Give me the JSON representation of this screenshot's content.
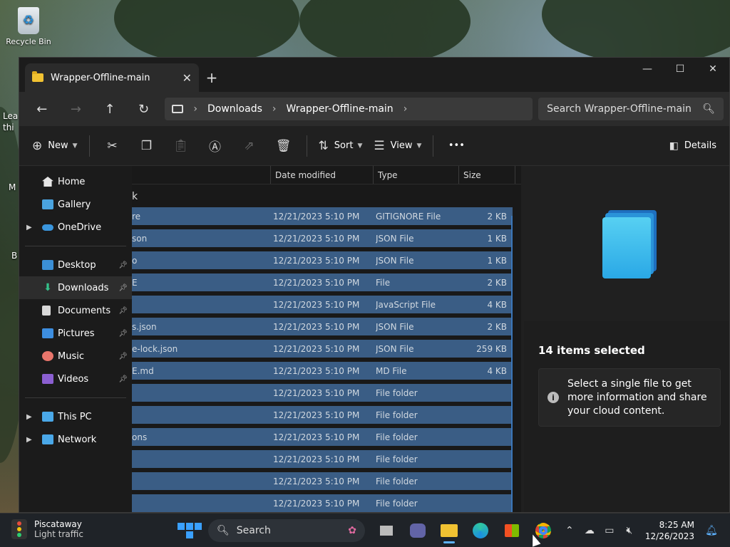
{
  "desktop": {
    "recycle_bin_label": "Recycle Bin",
    "partial_texts": [
      "Lea",
      "thi",
      "M",
      "B"
    ]
  },
  "window": {
    "tab_title": "Wrapper-Offline-main",
    "close_tab": "✕",
    "new_tab": "+",
    "minimize": "—",
    "maximize": "☐",
    "close": "✕"
  },
  "nav": {
    "back": "←",
    "forward": "→",
    "up": "↑",
    "refresh": "↻",
    "breadcrumbs": [
      "Downloads",
      "Wrapper-Offline-main"
    ],
    "sep": "›",
    "search_placeholder": "Search Wrapper-Offline-main"
  },
  "toolbar": {
    "new_label": "New",
    "sort_label": "Sort",
    "view_label": "View",
    "more_label": "•••",
    "details_label": "Details"
  },
  "sidebar": {
    "items": [
      {
        "label": "Home"
      },
      {
        "label": "Gallery"
      },
      {
        "label": "OneDrive"
      },
      {
        "label": "Desktop"
      },
      {
        "label": "Downloads"
      },
      {
        "label": "Documents"
      },
      {
        "label": "Pictures"
      },
      {
        "label": "Music"
      },
      {
        "label": "Videos"
      },
      {
        "label": "This PC"
      },
      {
        "label": "Network"
      }
    ]
  },
  "files": {
    "columns": {
      "date": "Date modified",
      "type": "Type",
      "size": "Size"
    },
    "group_label": "k",
    "rows": [
      {
        "name": "re",
        "date": "12/21/2023 5:10 PM",
        "type": "GITIGNORE File",
        "size": "2 KB"
      },
      {
        "name": "son",
        "date": "12/21/2023 5:10 PM",
        "type": "JSON File",
        "size": "1 KB"
      },
      {
        "name": "o",
        "date": "12/21/2023 5:10 PM",
        "type": "JSON File",
        "size": "1 KB"
      },
      {
        "name": "E",
        "date": "12/21/2023 5:10 PM",
        "type": "File",
        "size": "2 KB"
      },
      {
        "name": "",
        "date": "12/21/2023 5:10 PM",
        "type": "JavaScript File",
        "size": "4 KB"
      },
      {
        "name": "s.json",
        "date": "12/21/2023 5:10 PM",
        "type": "JSON File",
        "size": "2 KB"
      },
      {
        "name": "e-lock.json",
        "date": "12/21/2023 5:10 PM",
        "type": "JSON File",
        "size": "259 KB"
      },
      {
        "name": "E.md",
        "date": "12/21/2023 5:10 PM",
        "type": "MD File",
        "size": "4 KB"
      },
      {
        "name": "",
        "date": "12/21/2023 5:10 PM",
        "type": "File folder",
        "size": ""
      },
      {
        "name": "",
        "date": "12/21/2023 5:10 PM",
        "type": "File folder",
        "size": ""
      },
      {
        "name": "ons",
        "date": "12/21/2023 5:10 PM",
        "type": "File folder",
        "size": ""
      },
      {
        "name": "",
        "date": "12/21/2023 5:10 PM",
        "type": "File folder",
        "size": ""
      },
      {
        "name": "",
        "date": "12/21/2023 5:10 PM",
        "type": "File folder",
        "size": ""
      },
      {
        "name": "",
        "date": "12/21/2023 5:10 PM",
        "type": "File folder",
        "size": ""
      }
    ]
  },
  "details": {
    "selection_count": "14 items selected",
    "info_text": "Select a single file to get more information and share your cloud content.",
    "info_icon": "i"
  },
  "taskbar": {
    "weather_city": "Piscataway",
    "weather_status": "Light traffic",
    "search_label": "Search",
    "time": "8:25 AM",
    "date": "12/26/2023"
  }
}
